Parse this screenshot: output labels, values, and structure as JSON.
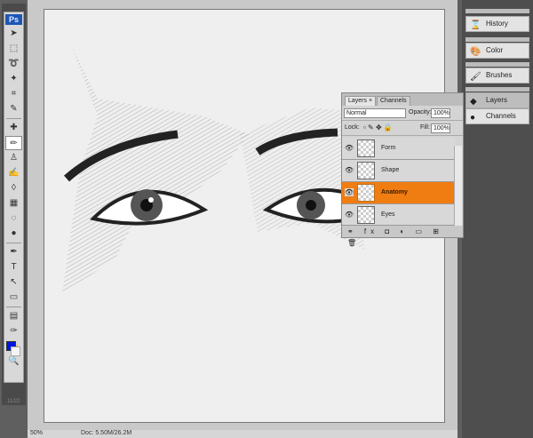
{
  "app": {
    "logo": "Ps",
    "version": "11/22"
  },
  "tools": [
    "move",
    "marquee",
    "lasso",
    "magic-wand",
    "crop",
    "eyedropper-slice",
    "healing",
    "brush",
    "stamp",
    "history-brush",
    "eraser",
    "gradient",
    "blur",
    "dodge",
    "pen",
    "type",
    "path-select",
    "shape",
    "notes",
    "eyedropper",
    "hand",
    "zoom"
  ],
  "tool_glyphs": [
    "➤",
    "⬚",
    "➰",
    "✦",
    "⌗",
    "✎",
    "✚",
    "✏",
    "♙",
    "✍",
    "◊",
    "▦",
    "◌",
    "●",
    "✒",
    "T",
    "↖",
    "▭",
    "▤",
    "✑",
    "✋",
    "🔍"
  ],
  "colors": {
    "foreground": "#0016e0",
    "background": "#f4f4f4",
    "accent": "#f07d12"
  },
  "status": {
    "zoom": "50%",
    "doc": "Doc: 5.50M/26.2M"
  },
  "dock": {
    "items": [
      {
        "label": "History",
        "icon": "history-icon"
      },
      {
        "label": "Color",
        "icon": "color-icon"
      },
      {
        "label": "Brushes",
        "icon": "brushes-icon"
      },
      {
        "label": "Layers",
        "icon": "layers-icon"
      },
      {
        "label": "Channels",
        "icon": "channels-icon"
      }
    ]
  },
  "layers_panel": {
    "tabs": [
      "Layers ×",
      "Channels"
    ],
    "blend_mode": "Normal",
    "opacity_label": "Opacity:",
    "opacity": "100%",
    "lock_label": "Lock:",
    "fill_label": "Fill:",
    "fill": "100%",
    "layers": [
      {
        "name": "Form"
      },
      {
        "name": "Shape"
      },
      {
        "name": "Anatomy",
        "selected": true
      },
      {
        "name": "Eyes"
      }
    ],
    "bottom_icons": "⚭ fx ◘ ◐ ▭ ⊞ 🗑"
  }
}
